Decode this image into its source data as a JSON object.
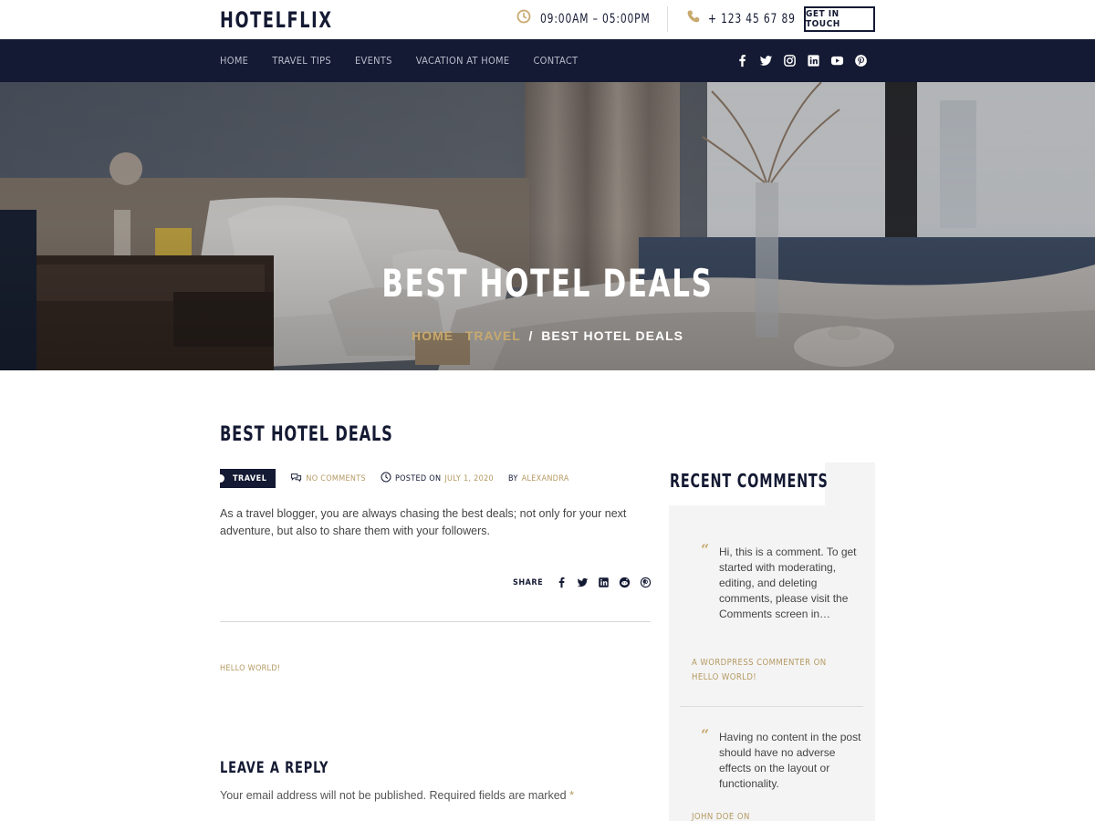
{
  "header": {
    "logo": "HOTELFLIX",
    "hours": "09:00AM – 05:00PM",
    "phone": "+ 123 45 67 89",
    "cta_label": "GET IN TOUCH"
  },
  "nav": {
    "items": [
      "HOME",
      "TRAVEL TIPS",
      "EVENTS",
      "VACATION AT HOME",
      "CONTACT"
    ],
    "social_icons": [
      "facebook-icon",
      "twitter-icon",
      "instagram-icon",
      "linkedin-icon",
      "youtube-icon",
      "pinterest-icon"
    ]
  },
  "hero": {
    "title": "BEST HOTEL DEALS",
    "breadcrumb": {
      "home": "HOME",
      "category": "TRAVEL",
      "separator": "/",
      "current": "BEST HOTEL DEALS"
    }
  },
  "post": {
    "title": "BEST HOTEL DEALS",
    "category": "TRAVEL",
    "comments_label": "NO COMMENTS",
    "posted_on_label": "POSTED ON",
    "date": "JULY 1, 2020",
    "by_label": "BY",
    "author": "ALEXANDRA",
    "excerpt": "As a travel blogger, you are always chasing the best deals; not only for your next adventure, but also to share them with your followers.",
    "share_label": "SHARE",
    "share_icons": [
      "facebook-icon",
      "twitter-icon",
      "linkedin-icon",
      "reddit-icon",
      "pinterest-icon"
    ],
    "prev_post": "HELLO WORLD!"
  },
  "reply": {
    "title": "LEAVE A REPLY",
    "note": "Your email address will not be published. Required fields are marked",
    "required_mark": "*"
  },
  "sidebar": {
    "title": "RECENT COMMENTS",
    "comments": [
      {
        "text": "Hi, this is a comment. To get started with moderating, editing, and deleting comments, please visit the Comments screen in…",
        "author": "A WORDPRESS COMMENTER",
        "on": "ON",
        "post": "HELLO WORLD!"
      },
      {
        "text": "Having no content in the post should have no adverse effects on the layout or functionality.",
        "author": "JOHN DOE",
        "on": "ON",
        "post": ""
      }
    ]
  },
  "colors": {
    "navy": "#141a33",
    "gold": "#c8a96e",
    "nav_text": "#b8bccc",
    "sidebar_bg": "#f4f4f4"
  }
}
